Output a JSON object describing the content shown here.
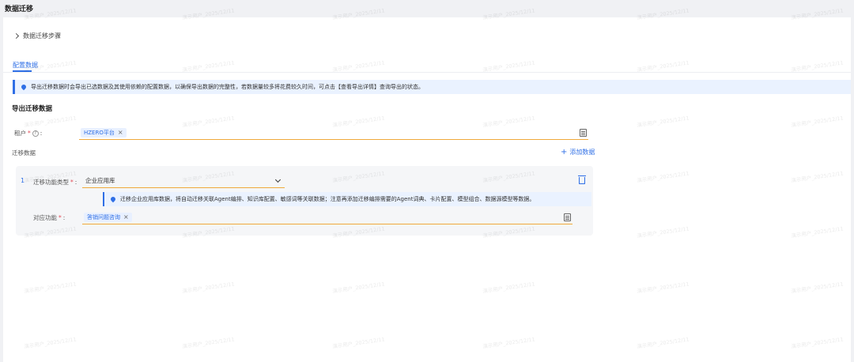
{
  "page": {
    "title": "数据迁移"
  },
  "steps": {
    "label": "数据迁移步骤"
  },
  "tabs": [
    {
      "label": "配置数据",
      "active": true
    }
  ],
  "info": {
    "text": "导出迁移数据时会导出已选数据及其使用依赖的配置数据，以确保导出数据的完整性，若数据量较多将花费较久时间，可点击【查看导出详情】查询导出的状态。"
  },
  "export_section": {
    "title": "导出迁移数据"
  },
  "tenant": {
    "label": "租户",
    "required_mark": "*",
    "help_glyph": "?",
    "colon": ":",
    "tag": "HZERO平台"
  },
  "migration": {
    "label": "迁移数据",
    "add_button": "添加数据",
    "items": [
      {
        "index": "1",
        "type_label": "迁移功能类型",
        "type_value": "企业应用库",
        "info": "迁移企业应用库数据，将自动迁移关联Agent编排、知识库配置、敏感词等关联数据；注意再添加迁移编排需要的Agent词典、卡片配置、模型组合、数据源模型等数据。",
        "function_label": "对应功能",
        "function_tag": "答销问题咨询"
      }
    ]
  },
  "watermark": {
    "text": "演示用户_2025/12/11"
  },
  "colors": {
    "accent": "#2f6fe6",
    "required": "#e34d59",
    "focus_border": "#f0a93b"
  }
}
